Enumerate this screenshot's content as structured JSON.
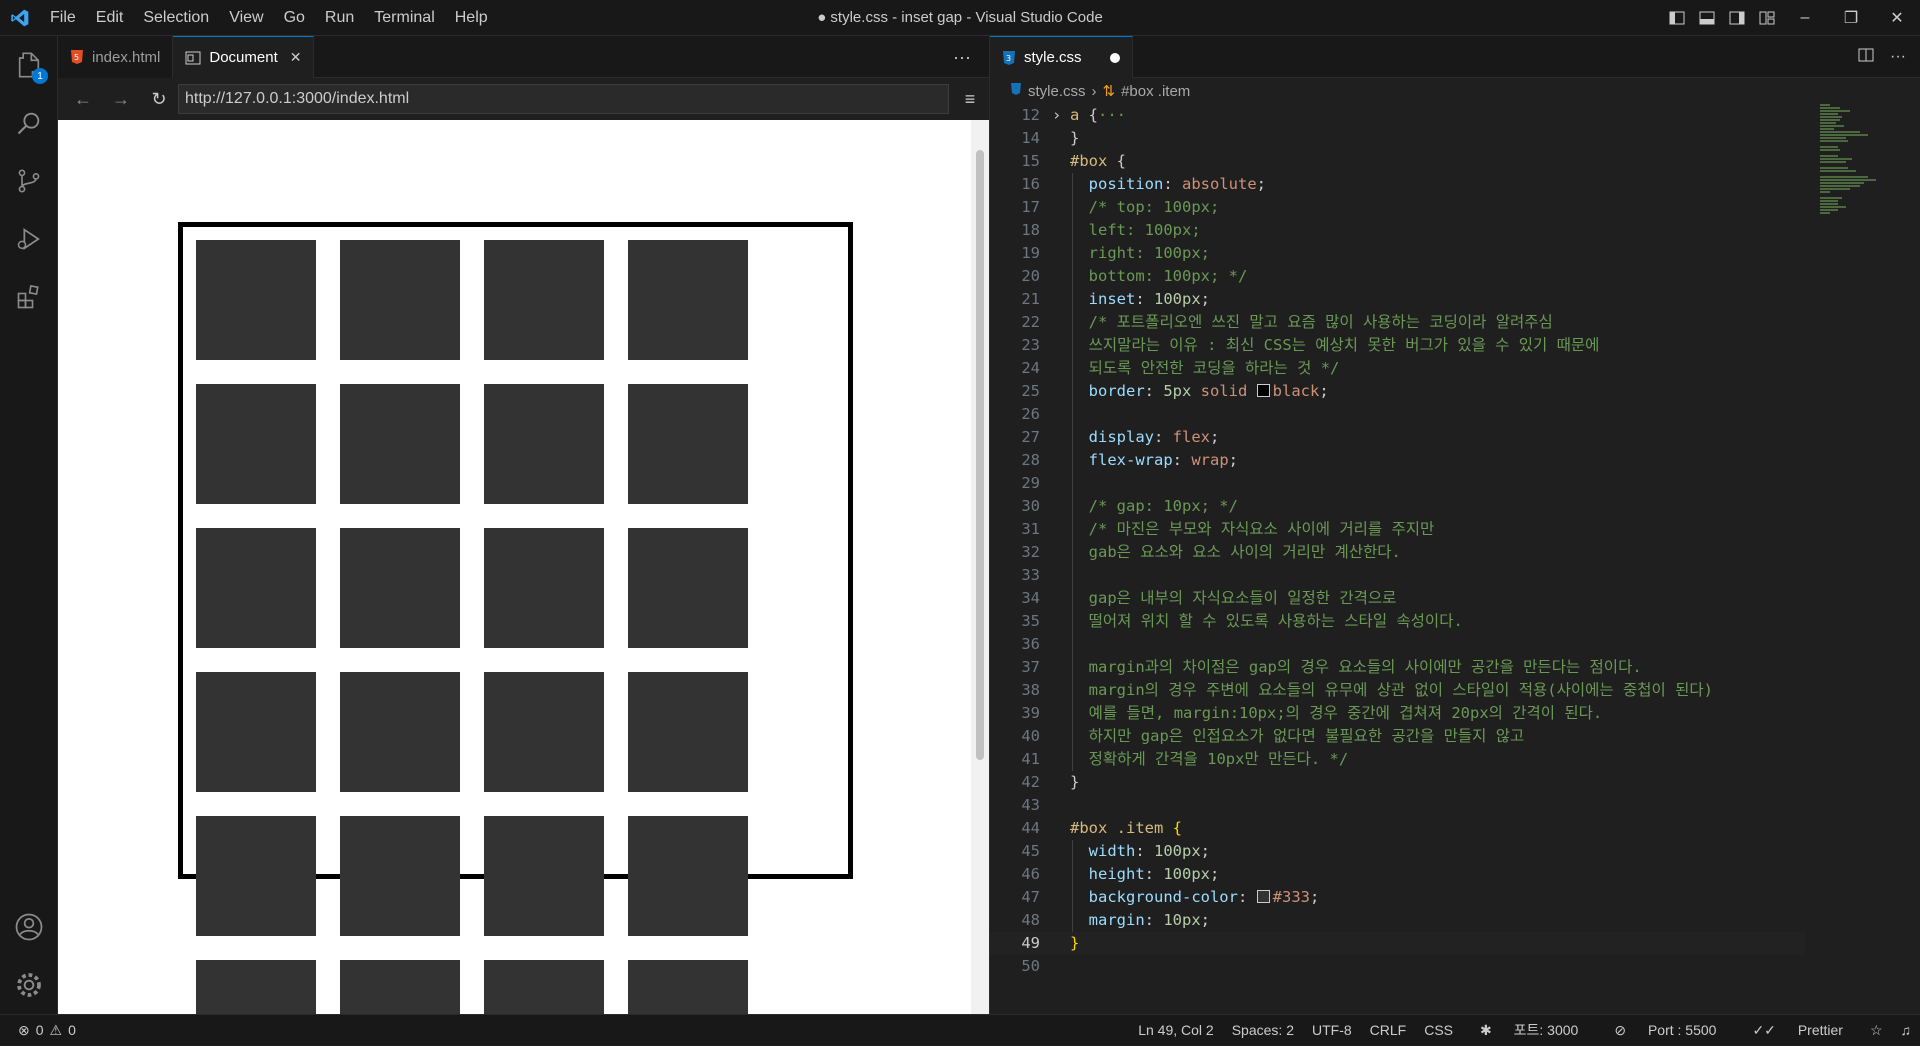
{
  "app": {
    "window_title": "● style.css - inset gap - Visual Studio Code",
    "menus": [
      "File",
      "Edit",
      "Selection",
      "View",
      "Go",
      "Run",
      "Terminal",
      "Help"
    ]
  },
  "activity": {
    "explorer_badge": "1"
  },
  "left": {
    "tabs": [
      {
        "label": "index.html"
      },
      {
        "label": "Document"
      }
    ],
    "url": "http://127.0.0.1:3000/index.html"
  },
  "preview": {
    "item_color": "#333333",
    "item_count_visible": 24
  },
  "right": {
    "tab_label": "style.css",
    "breadcrumb": {
      "file": "style.css",
      "symbol": "#box .item"
    }
  },
  "code": {
    "active_line": 49,
    "lines": [
      {
        "n": "12",
        "t": [
          [
            "sel",
            "a "
          ],
          [
            "punc",
            "{"
          ],
          [
            "cmt",
            "···"
          ]
        ],
        "fold": true
      },
      {
        "n": "14",
        "t": [
          [
            "punc",
            "}"
          ]
        ]
      },
      {
        "n": "15",
        "t": [
          [
            "sel",
            "#box "
          ],
          [
            "punc",
            "{"
          ]
        ]
      },
      {
        "n": "16",
        "t": [
          [
            "prop",
            "  position"
          ],
          [
            "punc",
            ": "
          ],
          [
            "val",
            "absolute"
          ],
          [
            "punc",
            ";"
          ]
        ]
      },
      {
        "n": "17",
        "t": [
          [
            "cmt",
            "  /* top: 100px;"
          ]
        ]
      },
      {
        "n": "18",
        "t": [
          [
            "cmt",
            "  left: 100px;"
          ]
        ]
      },
      {
        "n": "19",
        "t": [
          [
            "cmt",
            "  right: 100px;"
          ]
        ]
      },
      {
        "n": "20",
        "t": [
          [
            "cmt",
            "  bottom: 100px; */"
          ]
        ]
      },
      {
        "n": "21",
        "t": [
          [
            "prop",
            "  inset"
          ],
          [
            "punc",
            ": "
          ],
          [
            "num",
            "100px"
          ],
          [
            "punc",
            ";"
          ]
        ]
      },
      {
        "n": "22",
        "t": [
          [
            "cmt",
            "  /* 포트폴리오엔 쓰진 말고 요즘 많이 사용하는 코딩이라 알려주심"
          ]
        ]
      },
      {
        "n": "23",
        "t": [
          [
            "cmt",
            "  쓰지말라는 이유 : 최신 CSS는 예상치 못한 버그가 있을 수 있기 때문에"
          ]
        ]
      },
      {
        "n": "24",
        "t": [
          [
            "cmt",
            "  되도록 안전한 코딩을 하라는 것 */"
          ]
        ]
      },
      {
        "n": "25",
        "t": [
          [
            "prop",
            "  border"
          ],
          [
            "punc",
            ": "
          ],
          [
            "num",
            "5px "
          ],
          [
            "val",
            "solid "
          ],
          [
            "swatch",
            "#000000"
          ],
          [
            "val",
            "black"
          ],
          [
            "punc",
            ";"
          ]
        ]
      },
      {
        "n": "26",
        "t": []
      },
      {
        "n": "27",
        "t": [
          [
            "prop",
            "  display"
          ],
          [
            "punc",
            ": "
          ],
          [
            "val",
            "flex"
          ],
          [
            "punc",
            ";"
          ]
        ]
      },
      {
        "n": "28",
        "t": [
          [
            "prop",
            "  flex-wrap"
          ],
          [
            "punc",
            ": "
          ],
          [
            "val",
            "wrap"
          ],
          [
            "punc",
            ";"
          ]
        ]
      },
      {
        "n": "29",
        "t": []
      },
      {
        "n": "30",
        "t": [
          [
            "cmt",
            "  /* gap: 10px; */"
          ]
        ]
      },
      {
        "n": "31",
        "t": [
          [
            "cmt",
            "  /* 마진은 부모와 자식요소 사이에 거리를 주지만"
          ]
        ]
      },
      {
        "n": "32",
        "t": [
          [
            "cmt",
            "  gab은 요소와 요소 사이의 거리만 계산한다."
          ]
        ]
      },
      {
        "n": "33",
        "t": []
      },
      {
        "n": "34",
        "t": [
          [
            "cmt",
            "  gap은 내부의 자식요소들이 일정한 간격으로"
          ]
        ]
      },
      {
        "n": "35",
        "t": [
          [
            "cmt",
            "  떨어져 위치 할 수 있도록 사용하는 스타일 속성이다."
          ]
        ]
      },
      {
        "n": "36",
        "t": []
      },
      {
        "n": "37",
        "t": [
          [
            "cmt",
            "  margin과의 차이점은 gap의 경우 요소들의 사이에만 공간을 만든다는 점이다."
          ]
        ]
      },
      {
        "n": "38",
        "t": [
          [
            "cmt",
            "  margin의 경우 주변에 요소들의 유무에 상관 없이 스타일이 적용(사이에는 중첩이 된다)"
          ]
        ]
      },
      {
        "n": "39",
        "t": [
          [
            "cmt",
            "  예를 들면, margin:10px;의 경우 중간에 겹쳐져 20px의 간격이 된다."
          ]
        ]
      },
      {
        "n": "40",
        "t": [
          [
            "cmt",
            "  하지만 gap은 인접요소가 없다면 불필요한 공간을 만들지 않고"
          ]
        ]
      },
      {
        "n": "41",
        "t": [
          [
            "cmt",
            "  정확하게 간격을 10px만 만든다. */"
          ]
        ]
      },
      {
        "n": "42",
        "t": [
          [
            "punc",
            "}"
          ]
        ]
      },
      {
        "n": "43",
        "t": []
      },
      {
        "n": "44",
        "t": [
          [
            "sel",
            "#box .item "
          ],
          [
            "brace",
            "{"
          ]
        ]
      },
      {
        "n": "45",
        "t": [
          [
            "prop",
            "  width"
          ],
          [
            "punc",
            ": "
          ],
          [
            "num",
            "100px"
          ],
          [
            "punc",
            ";"
          ]
        ]
      },
      {
        "n": "46",
        "t": [
          [
            "prop",
            "  height"
          ],
          [
            "punc",
            ": "
          ],
          [
            "num",
            "100px"
          ],
          [
            "punc",
            ";"
          ]
        ]
      },
      {
        "n": "47",
        "t": [
          [
            "prop",
            "  background-color"
          ],
          [
            "punc",
            ": "
          ],
          [
            "swatch",
            "#333333"
          ],
          [
            "val",
            "#333"
          ],
          [
            "punc",
            ";"
          ]
        ]
      },
      {
        "n": "48",
        "t": [
          [
            "prop",
            "  margin"
          ],
          [
            "punc",
            ": "
          ],
          [
            "num",
            "10px"
          ],
          [
            "punc",
            ";"
          ]
        ]
      },
      {
        "n": "49",
        "t": [
          [
            "brace",
            "}"
          ]
        ]
      },
      {
        "n": "50",
        "t": []
      }
    ]
  },
  "status": {
    "errors": "0",
    "warnings": "0",
    "position": "Ln 49, Col 2",
    "spaces": "Spaces: 2",
    "encoding": "UTF-8",
    "eol": "CRLF",
    "language": "CSS",
    "forward_port": "포트: 3000",
    "port": "Port : 5500",
    "prettier": "Prettier"
  }
}
